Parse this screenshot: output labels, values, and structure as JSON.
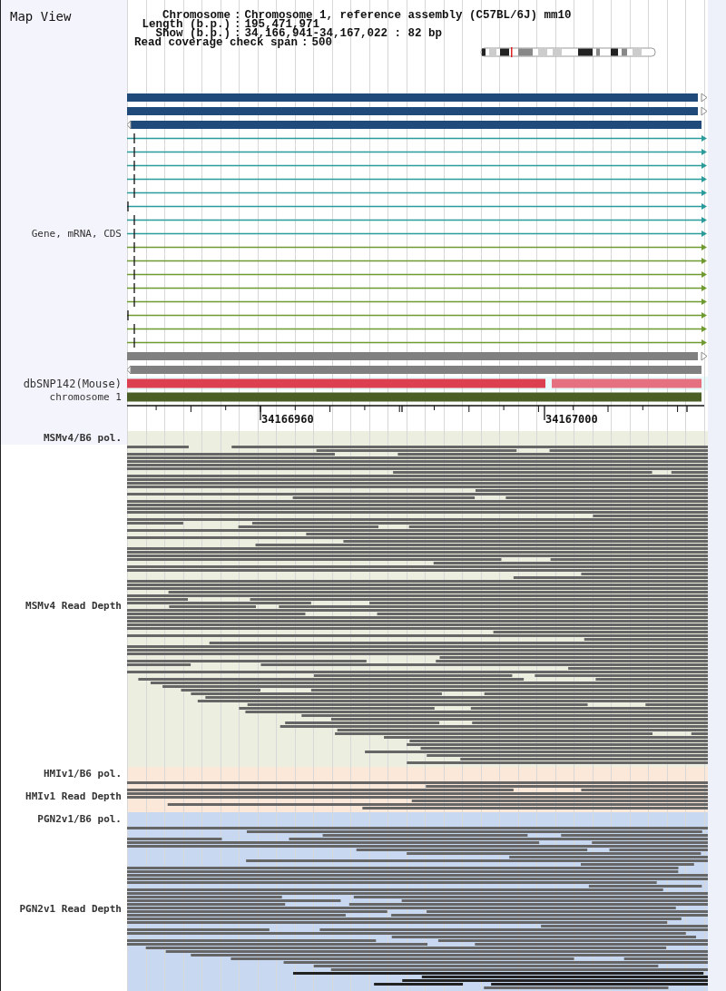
{
  "title": "Map View",
  "separator": ":",
  "info": [
    {
      "kind": "aligned",
      "label": "Chromosome",
      "value": "Chromosome 1, reference assembly (C57BL/6J) mm10"
    },
    {
      "kind": "aligned",
      "label": "Length (b.p.)",
      "value": "195,471,971"
    },
    {
      "kind": "aligned",
      "label": "Show (b.p.)",
      "value": "34,166,941-34,167,022 : 82 bp"
    },
    {
      "kind": "free",
      "label": "Read coverage check span",
      "value": "500"
    }
  ],
  "gene_track": {
    "label": "Gene, mRNA, CDS",
    "features": [
      {
        "kind": "block",
        "color": "#1f4a7a",
        "reverse": false
      },
      {
        "kind": "block",
        "color": "#1f4a7a",
        "reverse": false
      },
      {
        "kind": "block",
        "color": "#1f4a7a",
        "reverse": true
      },
      {
        "kind": "line",
        "color": "#2a9a9a",
        "reverse": false,
        "starts_at_edge": false
      },
      {
        "kind": "line",
        "color": "#2a9a9a",
        "reverse": false,
        "starts_at_edge": false
      },
      {
        "kind": "line",
        "color": "#2a9a9a",
        "reverse": false,
        "starts_at_edge": false
      },
      {
        "kind": "line",
        "color": "#2a9a9a",
        "reverse": false,
        "starts_at_edge": false
      },
      {
        "kind": "line",
        "color": "#2a9a9a",
        "reverse": false,
        "starts_at_edge": false
      },
      {
        "kind": "line",
        "color": "#2a9a9a",
        "reverse": false,
        "starts_at_edge": true
      },
      {
        "kind": "line",
        "color": "#2a9a9a",
        "reverse": false,
        "starts_at_edge": false
      },
      {
        "kind": "line",
        "color": "#2a9a9a",
        "reverse": false,
        "starts_at_edge": false
      },
      {
        "kind": "line",
        "color": "#6e9a30",
        "reverse": false,
        "starts_at_edge": false
      },
      {
        "kind": "line",
        "color": "#6e9a30",
        "reverse": false,
        "starts_at_edge": false
      },
      {
        "kind": "line",
        "color": "#6e9a30",
        "reverse": false,
        "starts_at_edge": false
      },
      {
        "kind": "line",
        "color": "#6e9a30",
        "reverse": false,
        "starts_at_edge": false
      },
      {
        "kind": "line",
        "color": "#6e9a30",
        "reverse": false,
        "starts_at_edge": false
      },
      {
        "kind": "line",
        "color": "#6e9a30",
        "reverse": false,
        "starts_at_edge": true
      },
      {
        "kind": "line",
        "color": "#6e9a30",
        "reverse": false,
        "starts_at_edge": false
      },
      {
        "kind": "line",
        "color": "#6e9a30",
        "reverse": false,
        "starts_at_edge": false
      },
      {
        "kind": "block",
        "color": "#808080",
        "reverse": false
      },
      {
        "kind": "block",
        "color": "#808080",
        "reverse": true
      }
    ]
  },
  "snp_track": {
    "label": "dbSNP142(Mouse)",
    "segments": [
      {
        "color": "#dc4050"
      },
      {
        "color": "#e57080"
      }
    ]
  },
  "chromosome_track": {
    "label": "chromosome 1",
    "color": "#4a5e26"
  },
  "axis": {
    "labels": [
      "34166960",
      "34167000"
    ]
  },
  "samples": [
    {
      "pol_label": "MSMv4/B6 pol.",
      "depth_label": "MSMv4 Read Depth",
      "color": "#ecefdf"
    },
    {
      "pol_label": "HMIv1/B6 pol.",
      "depth_label": "HMIv1 Read Depth",
      "color": "#fce8d8"
    },
    {
      "pol_label": "PGN2v1/B6 pol.",
      "depth_label": "PGN2v1 Read Depth",
      "color": "#c8d8f0"
    }
  ]
}
